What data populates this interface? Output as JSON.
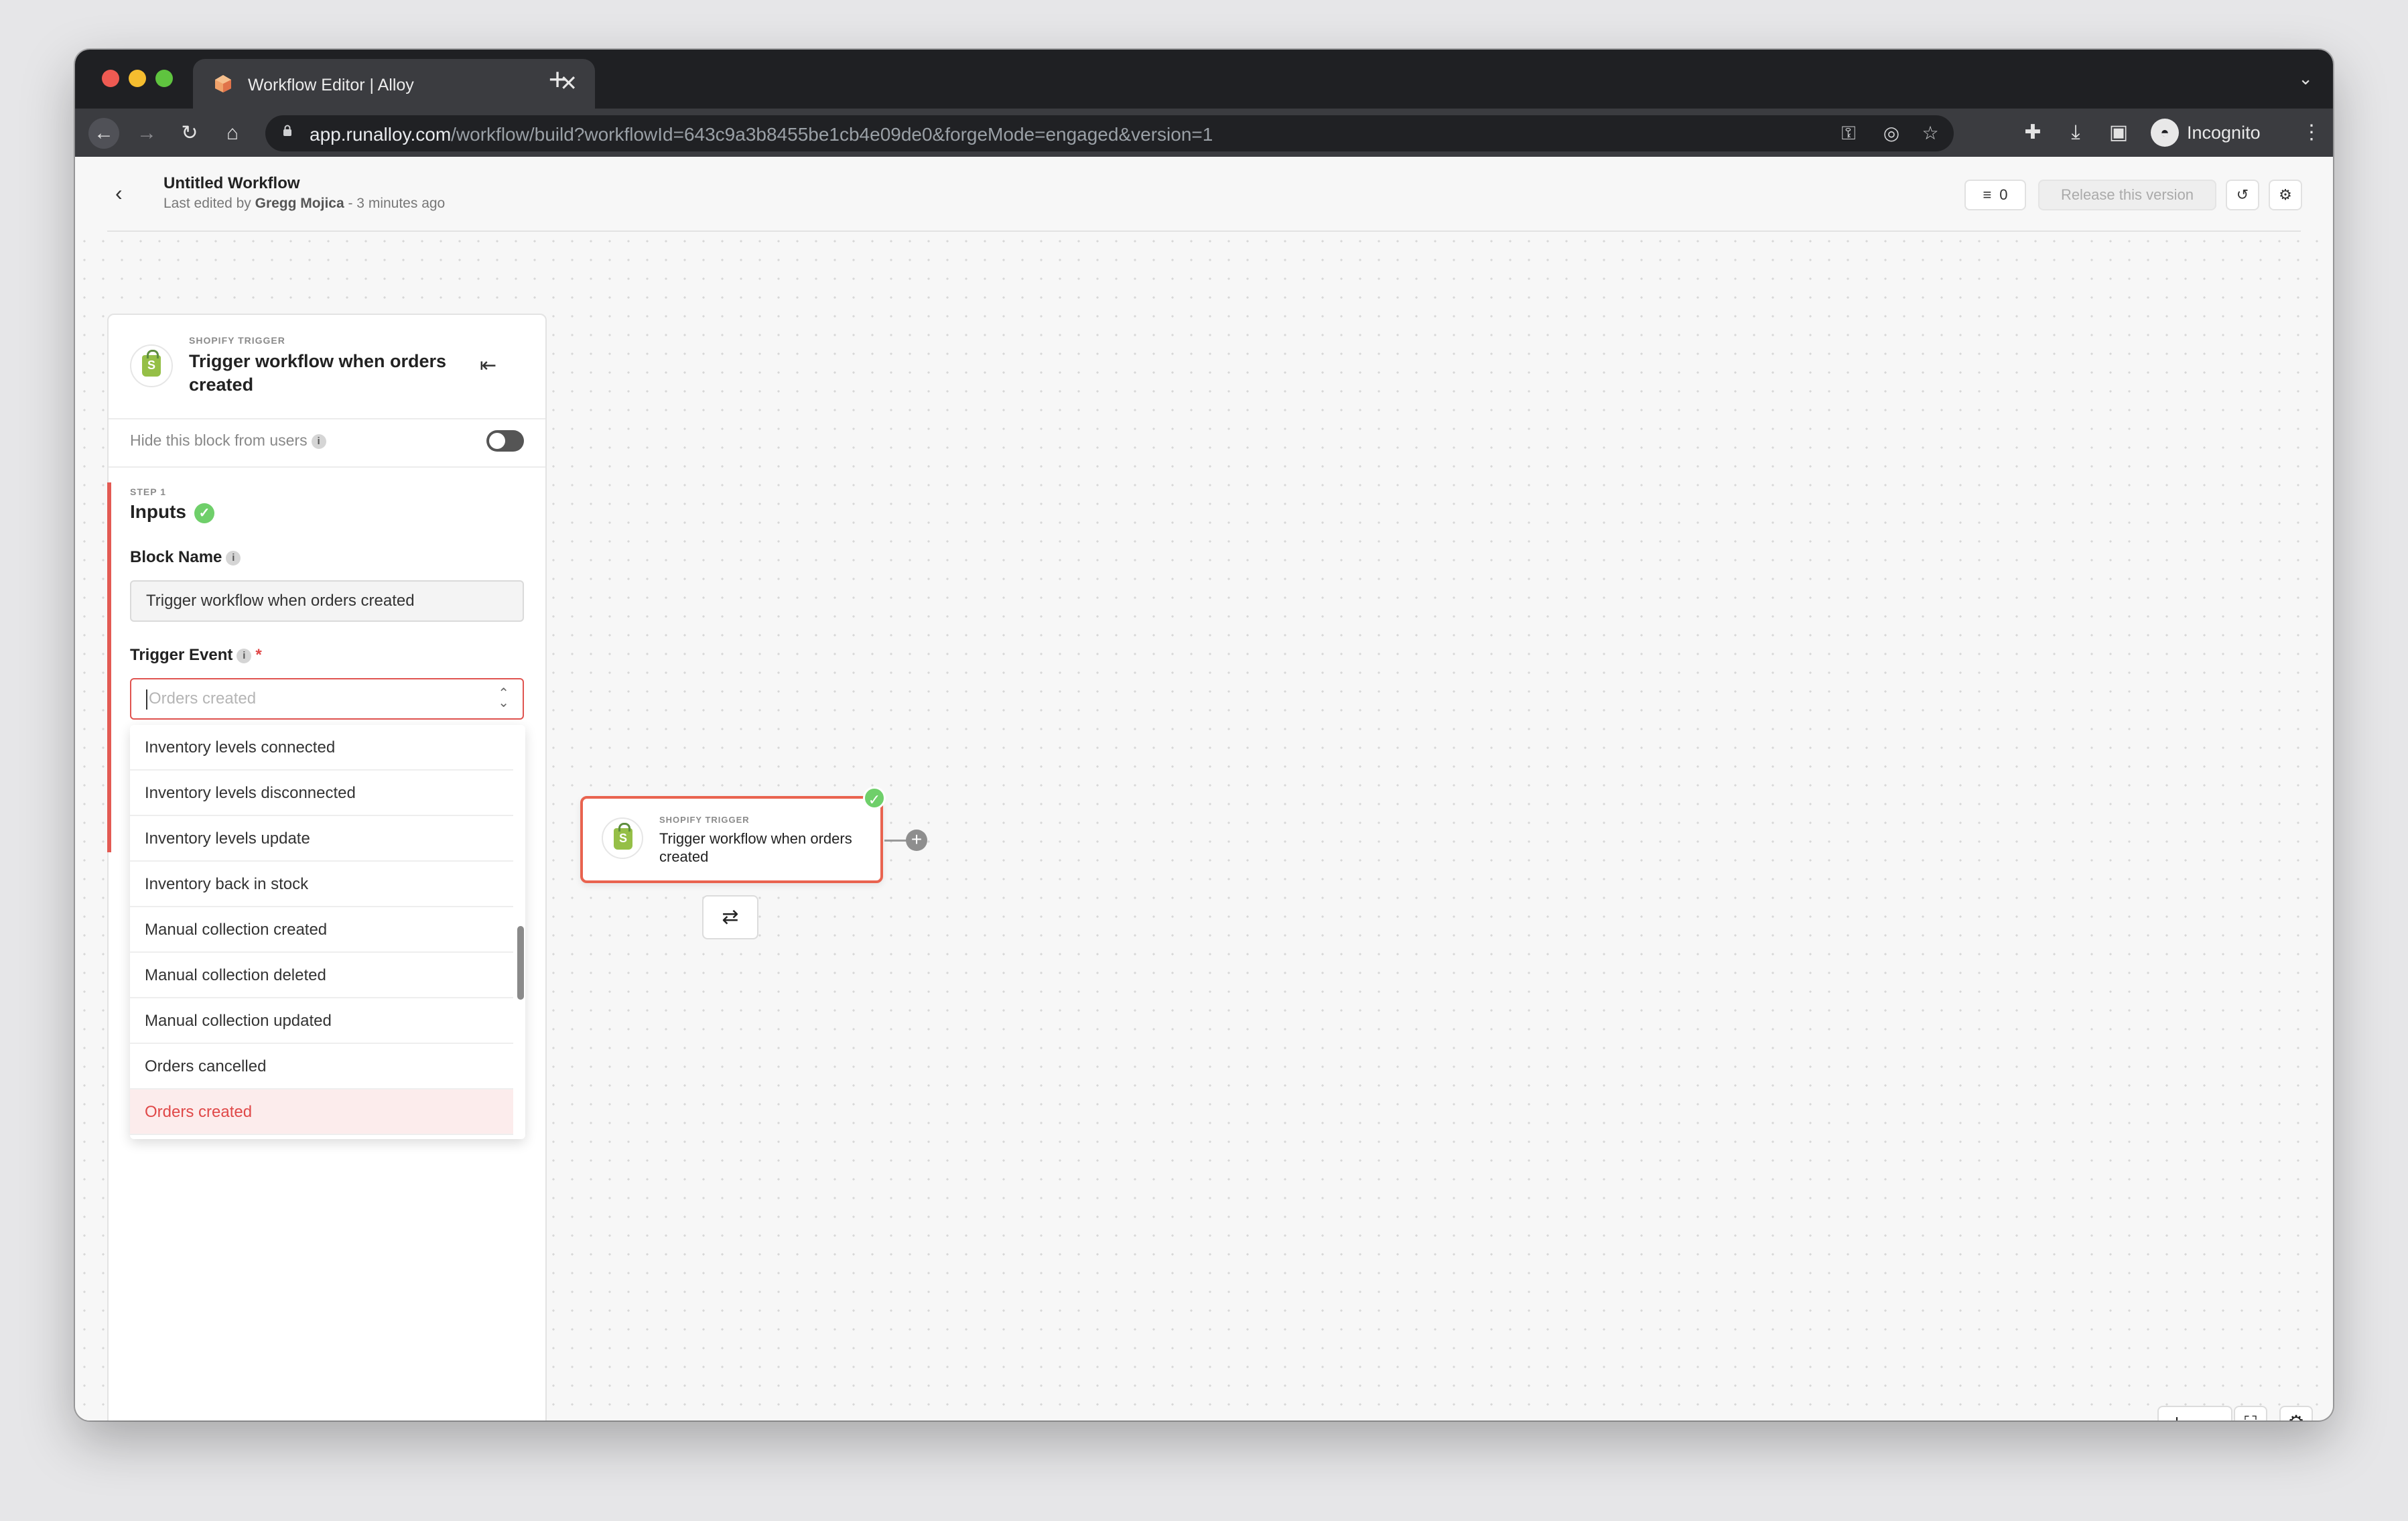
{
  "browser": {
    "tab_title": "Workflow Editor | Alloy",
    "new_tab_symbol": "+",
    "url_host": "app.runalloy.com",
    "url_path": "/workflow/build?workflowId=643c9a3b8455be1cb4e09de0&forgeMode=engaged&version=1",
    "profile_label": "Incognito",
    "colors": {
      "tab_bar": "#1f2023",
      "toolbar": "#3b3c40",
      "omnibox": "#202124"
    }
  },
  "header": {
    "title": "Untitled Workflow",
    "last_edited_prefix": "Last edited by",
    "last_edited_user": "Gregg Mojica",
    "last_edited_suffix": "- 3 minutes ago",
    "notes_count": "0",
    "release_label": "Release this version"
  },
  "panel": {
    "kicker": "SHOPIFY TRIGGER",
    "title": "Trigger workflow when orders created",
    "hide_label": "Hide this block from users",
    "hide_toggle_on": false,
    "step_kicker": "STEP 1",
    "step_title": "Inputs",
    "block_name_label": "Block Name",
    "block_name_value": "Trigger workflow when orders created",
    "trigger_event_label": "Trigger Event",
    "required_mark": "*",
    "trigger_event_placeholder": "Orders created",
    "dropdown_options": [
      "Inventory levels connected",
      "Inventory levels disconnected",
      "Inventory levels update",
      "Inventory back in stock",
      "Manual collection created",
      "Manual collection deleted",
      "Manual collection updated",
      "Orders cancelled",
      "Orders created"
    ],
    "selected_option": "Orders created"
  },
  "node": {
    "kicker": "SHOPIFY TRIGGER",
    "title": "Trigger workflow when orders created"
  },
  "zoom": {
    "in": "+",
    "out": "−"
  },
  "colors": {
    "accent": "#e35a53",
    "success": "#6fcf6a",
    "shopify": "#95bf47"
  }
}
